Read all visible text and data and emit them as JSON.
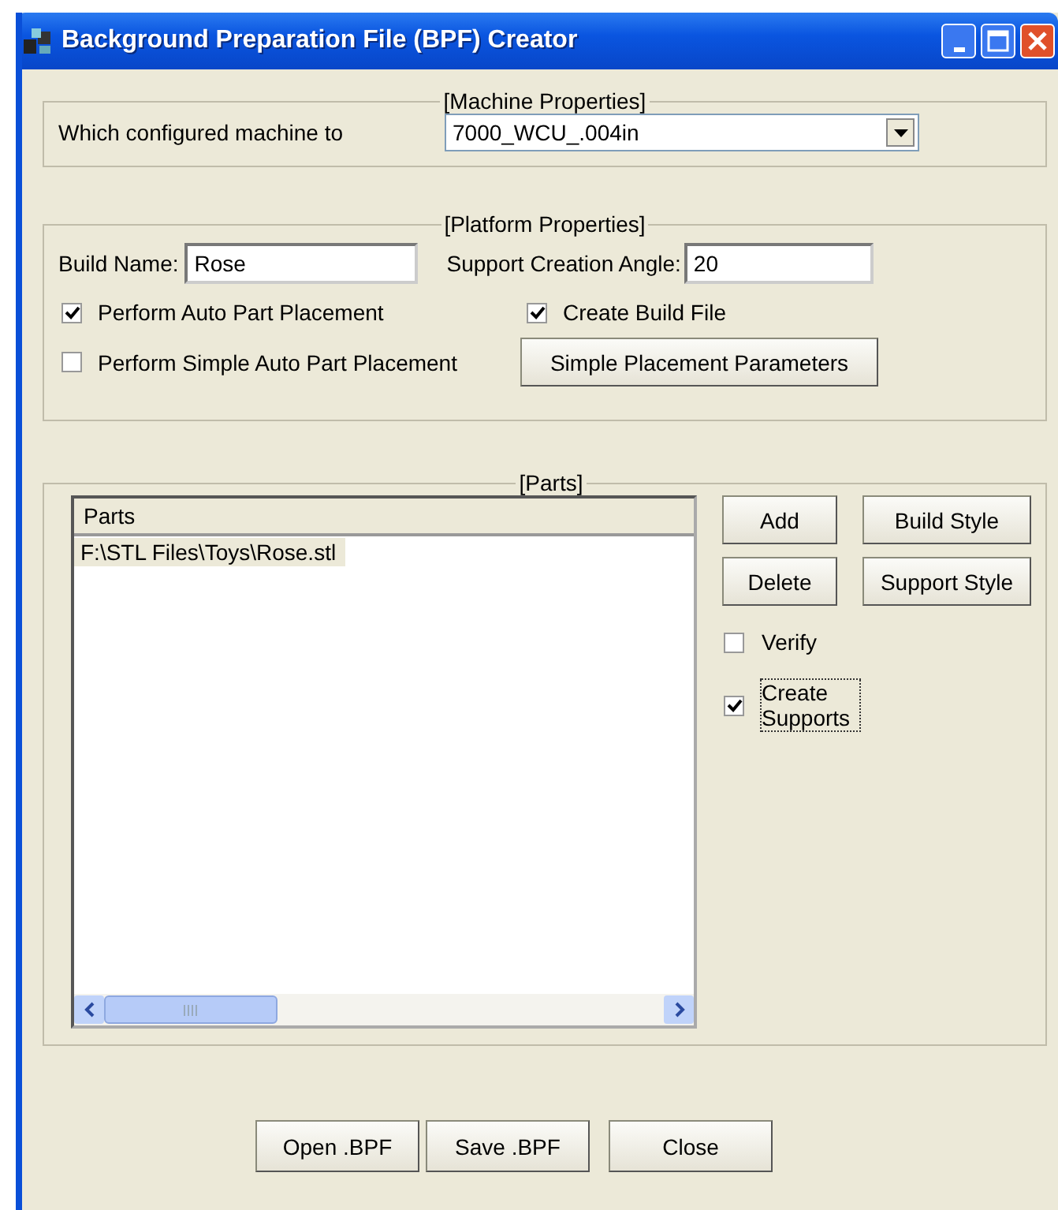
{
  "window": {
    "title": "Background Preparation File (BPF) Creator"
  },
  "machine_group": {
    "title": "[Machine Properties]",
    "label": "Which configured machine to",
    "machine": "7000_WCU_.004in"
  },
  "platform_group": {
    "title": "[Platform Properties]",
    "build_name_label": "Build Name:",
    "build_name": "Rose",
    "angle_label": "Support Creation Angle:",
    "angle": "20",
    "checkboxes": [
      {
        "label": "Perform Auto Part Placement",
        "checked": true
      },
      {
        "label": "Create Build File",
        "checked": true
      },
      {
        "label": "Perform Simple Auto Part Placement",
        "checked": false
      }
    ],
    "placement_button": "Simple Placement Parameters"
  },
  "parts_group": {
    "title": "[Parts]",
    "list": {
      "column": "Parts",
      "rows": [
        {
          "text": "F:\\STL Files\\Toys\\Rose.stl",
          "selected": true
        }
      ]
    },
    "buttons": [
      "Add",
      "Build Style",
      "Delete",
      "Support Style"
    ],
    "options": [
      {
        "label": "Verify",
        "checked": false,
        "focused": false
      },
      {
        "label": "Create Supports",
        "checked": true,
        "focused": true
      }
    ]
  },
  "buttons": [
    "Open .BPF",
    "Save .BPF",
    "Close"
  ]
}
